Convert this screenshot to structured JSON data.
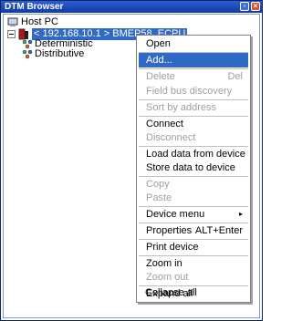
{
  "window": {
    "title": "DTM Browser"
  },
  "tree": {
    "root": "Host PC",
    "cpu_node": "< 192.168.10.1 > BMEP58_ECPU",
    "children": [
      "Deterministic",
      "Distributive"
    ]
  },
  "context_menu": {
    "items": [
      {
        "label": "Open",
        "shortcut": "",
        "disabled": false
      },
      {
        "label": "Add...",
        "shortcut": "",
        "disabled": false,
        "highlighted": true
      },
      {
        "label": "Delete",
        "shortcut": "Del",
        "disabled": true
      },
      {
        "label": "Field bus discovery",
        "shortcut": "",
        "disabled": true
      },
      {
        "label": "Sort by address",
        "shortcut": "",
        "disabled": true
      },
      {
        "label": "Connect",
        "shortcut": "",
        "disabled": false
      },
      {
        "label": "Disconnect",
        "shortcut": "",
        "disabled": true
      },
      {
        "label": "Load data from device",
        "shortcut": "",
        "disabled": false
      },
      {
        "label": "Store data to device",
        "shortcut": "",
        "disabled": false
      },
      {
        "label": "Copy",
        "shortcut": "",
        "disabled": true
      },
      {
        "label": "Paste",
        "shortcut": "",
        "disabled": true
      },
      {
        "label": "Device menu",
        "shortcut": "▸",
        "disabled": false
      },
      {
        "label": "Properties",
        "shortcut": "ALT+Enter",
        "disabled": false
      },
      {
        "label": "Print device",
        "shortcut": "",
        "disabled": false
      },
      {
        "label": "Zoom in",
        "shortcut": "",
        "disabled": false
      },
      {
        "label": "Zoom out",
        "shortcut": "",
        "disabled": true
      },
      {
        "label": "Expand all",
        "shortcut": "",
        "disabled": false
      },
      {
        "label": "Collapse all",
        "shortcut": "",
        "disabled": false
      }
    ]
  },
  "colors": {
    "highlight": "#316ac5",
    "titlebar": "#1a48b8",
    "disabled_text": "#a0a0a0"
  }
}
